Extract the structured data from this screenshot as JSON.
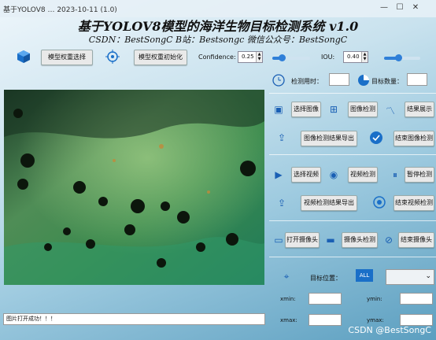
{
  "window": {
    "title_text": "基于YOLOV8 … 2023-10-11 (1.0)",
    "minimize": "—",
    "maximize": "☐",
    "close": "✕"
  },
  "header": {
    "title": "基于YOLOV8模型的海洋生物目标检测系统 v1.0",
    "subtitle": "CSDN：BestSongC   B站：Bestsongc   微信公众号：BestSongC"
  },
  "toolbar": {
    "select_weights": "模型权重选择",
    "init_weights": "模型权重初始化",
    "confidence_label": "Confidence:",
    "confidence_value": "0.25",
    "iou_label": "IOU:",
    "iou_value": "0.40",
    "confidence_fraction": 0.25,
    "iou_fraction": 0.4
  },
  "stats": {
    "time_label": "检测用时：",
    "time_value": "",
    "count_label": "目标数量：",
    "count_value": ""
  },
  "image_section": {
    "select_image": "选择图像",
    "detect_image": "图像检测",
    "show_results": "结果展示",
    "export_image_results": "图像检测结果导出",
    "end_image_detect": "结束图像检测"
  },
  "video_section": {
    "select_video": "选择视频",
    "detect_video": "视频检测",
    "pause_detect": "暂停检测",
    "export_video_results": "视频检测结果导出",
    "end_video_detect": "结束视频检测"
  },
  "camera_section": {
    "open_camera": "打开摄像头",
    "camera_detect": "摄像头检测",
    "close_camera": "结束摄像头"
  },
  "target_section": {
    "position_label": "目标位置：",
    "all_badge": "ALL",
    "xmin_label": "xmin:",
    "ymin_label": "ymin:",
    "xmax_label": "xmax:",
    "ymax_label": "ymax:"
  },
  "status": {
    "message": "图片打开成功！！！"
  },
  "watermark": "CSDN @BestSongC",
  "colors": {
    "accent": "#2f7fd8",
    "icon": "#1a5fb4"
  }
}
